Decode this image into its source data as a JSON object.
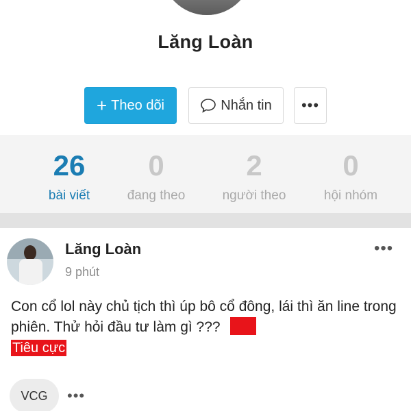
{
  "profile": {
    "name": "Lăng Loàn",
    "follow_label": "Theo dõi",
    "follow_icon": "plus-icon",
    "message_label": "Nhắn tin",
    "message_icon": "chat-bubble-icon",
    "more_label": "•••"
  },
  "stats": [
    {
      "value": "26",
      "label": "bài viết",
      "active": true
    },
    {
      "value": "0",
      "label": "đang theo",
      "active": false
    },
    {
      "value": "2",
      "label": "người theo",
      "active": false
    },
    {
      "value": "0",
      "label": "hội nhóm",
      "active": false
    }
  ],
  "post": {
    "author": "Lăng Loàn",
    "time": "9 phút",
    "more_label": "•••",
    "content": "Con cổ lol này chủ tịch thì úp bô cổ đông, lái thì ăn line trong phiên. Thử hỏi đầu tư làm gì ???",
    "sentiment_tag": "Tiêu cực",
    "stock_tag": "VCG",
    "footer_more_label": "•••"
  },
  "colors": {
    "accent": "#1fa6dd",
    "active_stat": "#1b7db3",
    "negative": "#e8141a"
  }
}
